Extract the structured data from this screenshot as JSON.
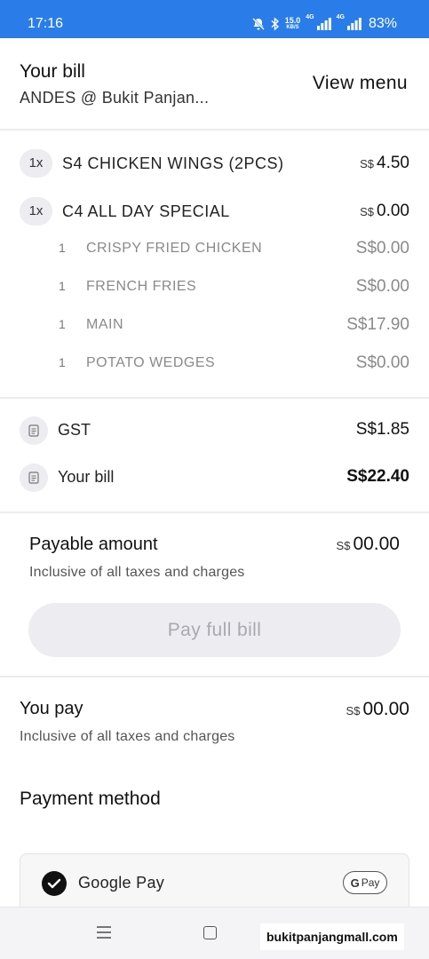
{
  "status_bar": {
    "time": "17:16",
    "net_speed": "15.0",
    "net_unit": "KB/S",
    "signal_1": "4G",
    "signal_2": "4G",
    "battery": "83%",
    "icons": [
      "mute-bell-icon",
      "bluetooth-icon",
      "signal-icon",
      "signal-icon",
      "battery"
    ]
  },
  "header": {
    "title": "Your bill",
    "restaurant": "ANDES @ Bukit Panjan...",
    "view_menu": "View menu"
  },
  "items": [
    {
      "qty": "1x",
      "name": "S4 CHICKEN WINGS (2PCS)",
      "currency": "S$",
      "price": "4.50"
    },
    {
      "qty": "1x",
      "name": "C4 ALL DAY SPECIAL",
      "currency": "S$",
      "price": "0.00",
      "sub_items": [
        {
          "qty": "1",
          "name": "CRISPY FRIED CHICKEN",
          "price": "S$0.00"
        },
        {
          "qty": "1",
          "name": "FRENCH FRIES",
          "price": "S$0.00"
        },
        {
          "qty": "1",
          "name": "MAIN",
          "price": "S$17.90"
        },
        {
          "qty": "1",
          "name": "POTATO WEDGES",
          "price": "S$0.00"
        }
      ]
    }
  ],
  "summary": {
    "gst_label": "GST",
    "gst_value": "S$1.85",
    "bill_label": "Your bill",
    "bill_value": "S$22.40"
  },
  "payable": {
    "title": "Payable amount",
    "currency": "S$",
    "amount": "00.00",
    "note": "Inclusive of all taxes and charges",
    "button": "Pay full bill"
  },
  "you_pay": {
    "title": "You pay",
    "currency": "S$",
    "amount": "00.00",
    "note": "Inclusive of all taxes and charges"
  },
  "payment_method": {
    "title": "Payment method",
    "option_label": "Google Pay",
    "badge_g": "G",
    "badge_text": "Pay"
  },
  "watermark": "bukitpanjangmall.com",
  "colors": {
    "status_bar": "#2a7de8",
    "pill_bg": "#ececf1",
    "disabled_text": "#a9a9b0"
  }
}
